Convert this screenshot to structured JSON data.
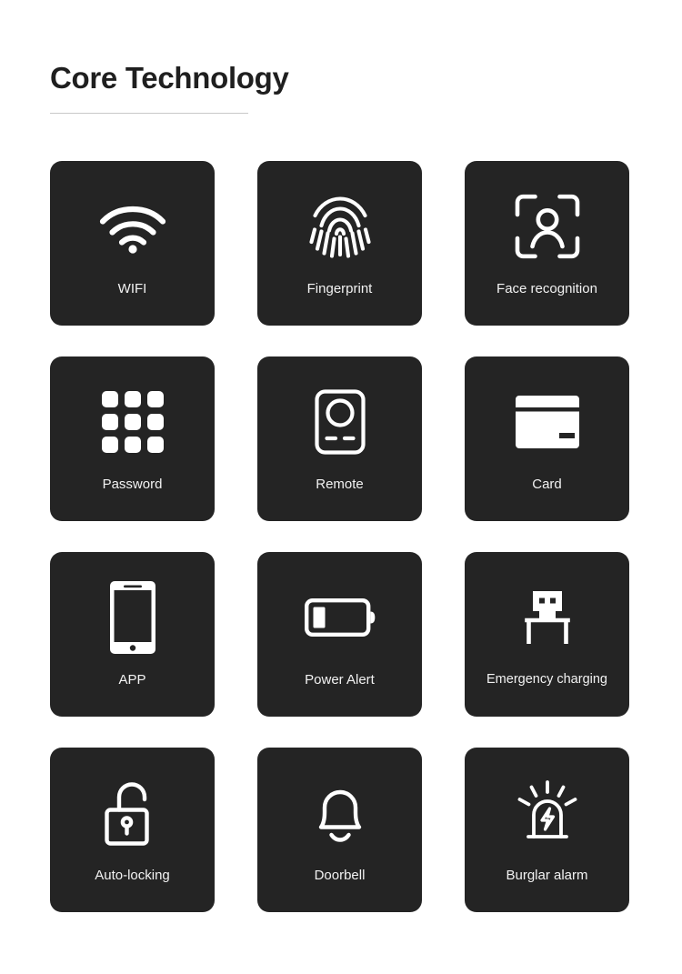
{
  "header": {
    "title": "Core Technology"
  },
  "theme": {
    "page_background": "#ffffff",
    "tile_background": "#242424",
    "icon_color": "#ffffff",
    "label_color": "#f2f2f2",
    "title_color": "#1f1f1f",
    "rule_color": "#c8c8c8"
  },
  "grid": {
    "columns": 3,
    "rows": 4,
    "items": [
      {
        "icon": "wifi-icon",
        "label": "WIFI"
      },
      {
        "icon": "fingerprint-icon",
        "label": "Fingerprint"
      },
      {
        "icon": "face-recognition-icon",
        "label": "Face recognition"
      },
      {
        "icon": "keypad-icon",
        "label": "Password"
      },
      {
        "icon": "remote-control-icon",
        "label": "Remote"
      },
      {
        "icon": "card-icon",
        "label": "Card"
      },
      {
        "icon": "smartphone-icon",
        "label": "APP"
      },
      {
        "icon": "low-battery-icon",
        "label": "Power Alert"
      },
      {
        "icon": "usb-plug-icon",
        "label": "Emergency charging"
      },
      {
        "icon": "open-padlock-icon",
        "label": "Auto-locking"
      },
      {
        "icon": "bell-icon",
        "label": "Doorbell"
      },
      {
        "icon": "siren-icon",
        "label": "Burglar alarm"
      }
    ]
  }
}
